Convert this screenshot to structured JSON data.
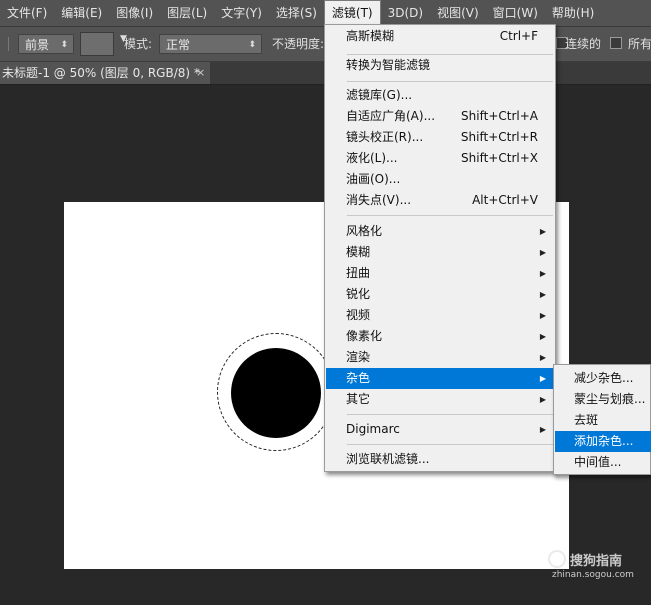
{
  "menubar": {
    "items": [
      "文件(F)",
      "编辑(E)",
      "图像(I)",
      "图层(L)",
      "文字(Y)",
      "选择(S)",
      "滤镜(T)",
      "3D(D)",
      "视图(V)",
      "窗口(W)",
      "帮助(H)"
    ]
  },
  "options": {
    "fill_source": "前景",
    "mode_label": "模式:",
    "mode_value": "正常",
    "opacity_label": "不透明度:",
    "contiguous_label": "连续的",
    "all_layers_label": "所有"
  },
  "document": {
    "tab_title": "未标题-1 @ 50% (图层 0, RGB/8) *",
    "close_glyph": "×"
  },
  "filter_menu": {
    "items": [
      {
        "label": "高斯模糊",
        "shortcut": "Ctrl+F"
      },
      {
        "label": "转换为智能滤镜",
        "shortcut": ""
      },
      {
        "label": "滤镜库(G)...",
        "shortcut": ""
      },
      {
        "label": "自适应广角(A)...",
        "shortcut": "Shift+Ctrl+A"
      },
      {
        "label": "镜头校正(R)...",
        "shortcut": "Shift+Ctrl+R"
      },
      {
        "label": "液化(L)...",
        "shortcut": "Shift+Ctrl+X"
      },
      {
        "label": "油画(O)...",
        "shortcut": ""
      },
      {
        "label": "消失点(V)...",
        "shortcut": "Alt+Ctrl+V"
      },
      {
        "label": "风格化",
        "shortcut": ""
      },
      {
        "label": "模糊",
        "shortcut": ""
      },
      {
        "label": "扭曲",
        "shortcut": ""
      },
      {
        "label": "锐化",
        "shortcut": ""
      },
      {
        "label": "视频",
        "shortcut": ""
      },
      {
        "label": "像素化",
        "shortcut": ""
      },
      {
        "label": "渲染",
        "shortcut": ""
      },
      {
        "label": "杂色",
        "shortcut": ""
      },
      {
        "label": "其它",
        "shortcut": ""
      },
      {
        "label": "Digimarc",
        "shortcut": ""
      },
      {
        "label": "浏览联机滤镜...",
        "shortcut": ""
      }
    ],
    "submenu_arrow": "▶"
  },
  "noise_submenu": {
    "items": [
      "减少杂色...",
      "蒙尘与划痕...",
      "去斑",
      "添加杂色...",
      "中间值..."
    ]
  },
  "watermark": {
    "title": "搜狗指南",
    "url": "zhinan.sogou.com"
  },
  "colors": {
    "highlight": "#0078d7",
    "menubar_bg": "#535353",
    "workspace_bg": "#282828"
  }
}
